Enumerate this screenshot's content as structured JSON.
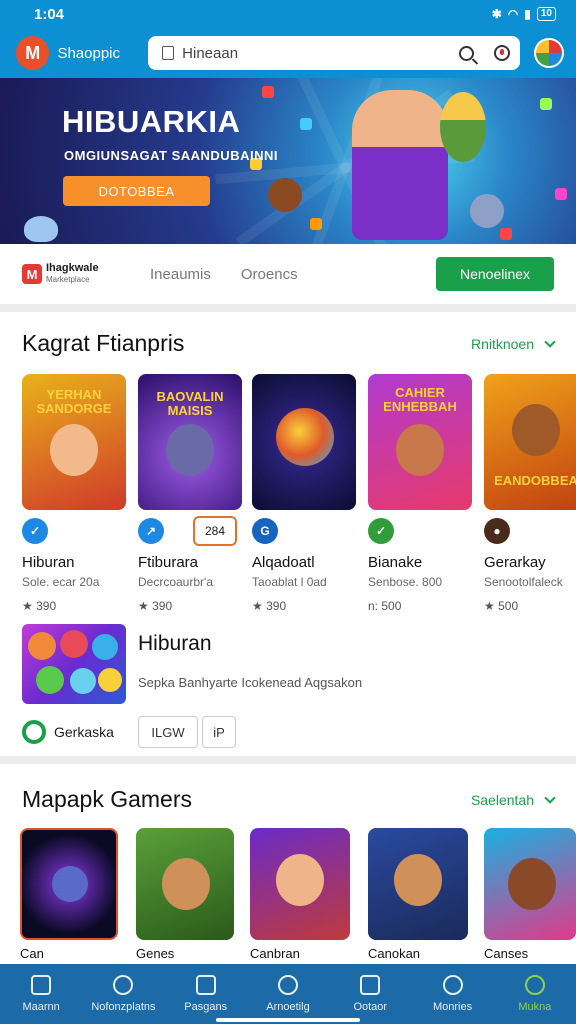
{
  "status_bar": {
    "time": "1:04",
    "battery": "10"
  },
  "header": {
    "brand": "Shaoppic",
    "search_placeholder": "Hineaan"
  },
  "banner": {
    "title": "HIBUARKIA",
    "subtitle": "OMGIUNSAGAT SAANDUBAINNI",
    "button_label": "DOTOBBEA"
  },
  "seller_row": {
    "logo_letter": "M",
    "name": "Ihagkwale",
    "tagline": "Marketplace",
    "tabs": [
      "Ineaumis",
      "Oroencs"
    ],
    "action_label": "Nenoelinex"
  },
  "section1": {
    "title": "Kagrat Ftianpris",
    "link": "Rnitknoen",
    "cards": [
      {
        "thumb_title": "YERHAN SANDORGE",
        "name": "Hiburan",
        "meta": "Sole. ecar 20a",
        "rating": "★ 390",
        "colors": [
          "#e8b21a",
          "#d03a2a"
        ]
      },
      {
        "thumb_title": "BAOVALIN MAISIS",
        "name": "Ftiburara",
        "meta": "Decrcoaurbr'a",
        "rating": "★ 390",
        "colors": [
          "#6a2bc8",
          "#2a0f6a"
        ]
      },
      {
        "thumb_title": "",
        "name": "Alqadoatl",
        "meta": "Taoablat l 0ad",
        "rating": "★ 390",
        "colors": [
          "#1d2b8a",
          "#090d30"
        ]
      },
      {
        "thumb_title": "CAHIER ENHEBBAH",
        "name": "Bianake",
        "meta": "Senbose. 800",
        "rating": "n: 500",
        "colors": [
          "#b03ad0",
          "#e83a6a"
        ]
      },
      {
        "thumb_title": "EANDOBBEA",
        "name": "Gerarkay",
        "meta": "Senootolfaleck",
        "rating": "★ 500",
        "colors": [
          "#f0a21a",
          "#c04010"
        ]
      }
    ],
    "price_badge": "284",
    "feature": {
      "title": "Hiburan",
      "description": "Sepka Banhyarte Icokenead Aqgsakon",
      "developer": "Gerkaska",
      "buttons": [
        "ILGW",
        "iP"
      ]
    }
  },
  "section2": {
    "title": "Mapapk Gamers",
    "link": "Saelentah",
    "cards": [
      {
        "name": "Can",
        "colors": [
          "#3a1a6a",
          "#0a0a25"
        ]
      },
      {
        "name": "Genes",
        "colors": [
          "#5aa03a",
          "#2a5a1a"
        ]
      },
      {
        "name": "Canbran",
        "colors": [
          "#6a2bc8",
          "#c03a3a"
        ]
      },
      {
        "name": "Canokan",
        "colors": [
          "#2a4aa0",
          "#1a2a5a"
        ]
      },
      {
        "name": "Canses",
        "colors": [
          "#1ab0e0",
          "#e03a8a"
        ]
      }
    ]
  },
  "bottom_nav": [
    {
      "label": "Maarnn",
      "icon": "home-icon"
    },
    {
      "label": "Nofonzplatns",
      "icon": "search-icon"
    },
    {
      "label": "Pasgans",
      "icon": "games-icon"
    },
    {
      "label": "Arnoetilg",
      "icon": "apps-icon"
    },
    {
      "label": "Ootaor",
      "icon": "book-icon"
    },
    {
      "label": "Monries",
      "icon": "people-icon"
    },
    {
      "label": "Mukna",
      "icon": "account-icon"
    }
  ]
}
